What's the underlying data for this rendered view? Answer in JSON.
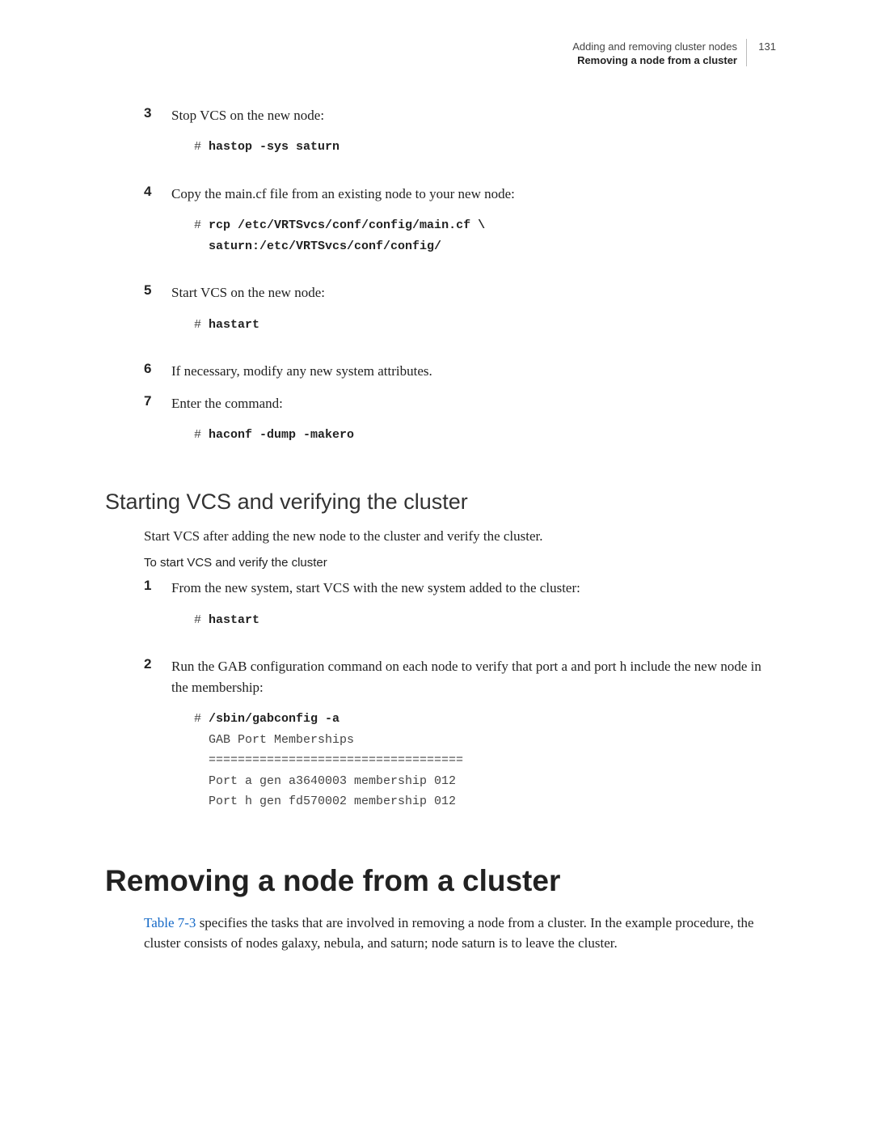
{
  "header": {
    "line1": "Adding and removing cluster nodes",
    "line2": "Removing a node from a cluster",
    "page_num": "131"
  },
  "upper_steps": [
    {
      "num": "3",
      "text": "Stop VCS on the new node:",
      "code": [
        {
          "prompt": "# ",
          "cmd": "hastop -sys saturn"
        }
      ]
    },
    {
      "num": "4",
      "text": "Copy the main.cf file from an existing node to your new node:",
      "code": [
        {
          "prompt": "# ",
          "cmd": "rcp /etc/VRTSvcs/conf/config/main.cf \\"
        },
        {
          "prompt": "  ",
          "cmd": "saturn:/etc/VRTSvcs/conf/config/"
        }
      ]
    },
    {
      "num": "5",
      "text": "Start VCS on the new node:",
      "code": [
        {
          "prompt": "# ",
          "cmd": "hastart"
        }
      ]
    },
    {
      "num": "6",
      "text": "If necessary, modify any new system attributes."
    },
    {
      "num": "7",
      "text": "Enter the command:",
      "code": [
        {
          "prompt": "# ",
          "cmd": "haconf -dump -makero"
        }
      ]
    }
  ],
  "section2": {
    "title": "Starting VCS and verifying the cluster",
    "intro": "Start VCS after adding the new node to the cluster and verify the cluster.",
    "subhead": "To start VCS and verify the cluster",
    "steps": [
      {
        "num": "1",
        "text": "From the new system, start VCS with the new system added to the cluster:",
        "code": [
          {
            "prompt": "# ",
            "cmd": "hastart"
          }
        ]
      },
      {
        "num": "2",
        "text": "Run the GAB configuration command on each node to verify that port a and port h include the new node in the membership:",
        "code": [
          {
            "prompt": "# ",
            "cmd": "/sbin/gabconfig -a"
          }
        ],
        "output": "  GAB Port Memberships\n  ===================================\n  Port a gen a3640003 membership 012\n  Port h gen fd570002 membership 012"
      }
    ]
  },
  "main_heading": "Removing a node from a cluster",
  "main_para": {
    "link": "Table 7-3",
    "rest": " specifies the tasks that are involved in removing a node from a cluster. In the example procedure, the cluster consists of nodes galaxy, nebula, and saturn; node saturn is to leave the cluster."
  }
}
